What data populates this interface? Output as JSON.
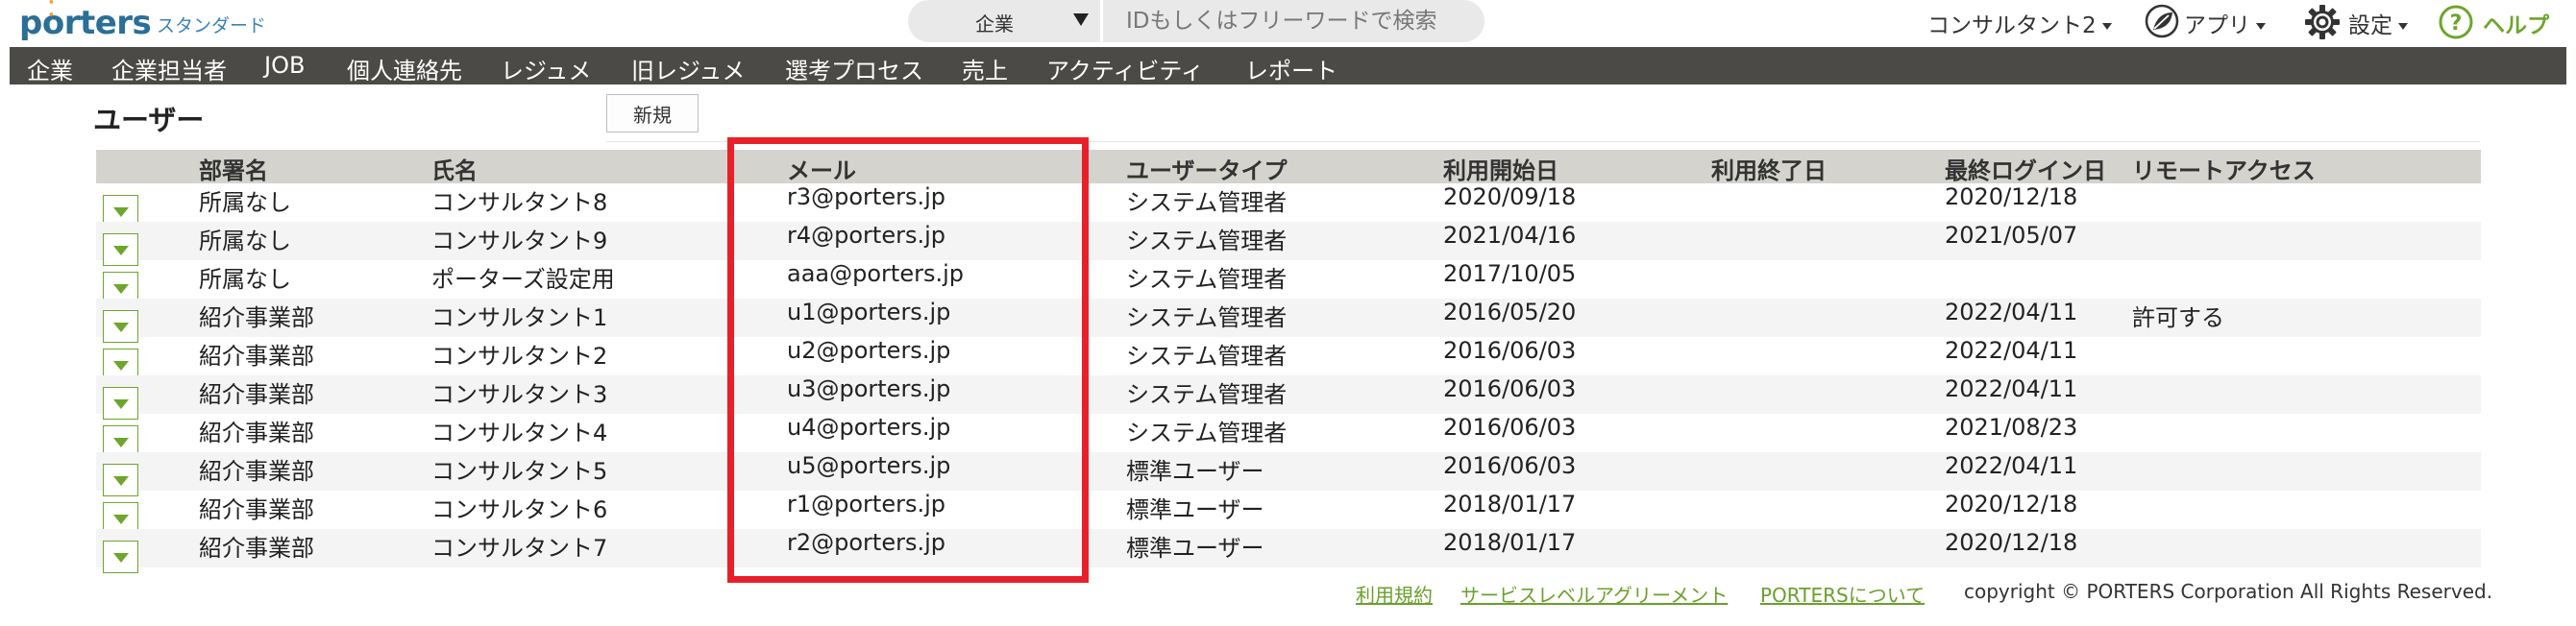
{
  "header": {
    "logo_prefix": "p",
    "logo_rest": "rters",
    "plan": "スタンダード",
    "search": {
      "category": "企業",
      "placeholder": "IDもしくはフリーワードで検索"
    },
    "user_menu": "コンサルタント2",
    "apps_label": "アプリ",
    "settings_label": "設定",
    "help_label": "ヘルプ"
  },
  "nav": [
    "企業",
    "企業担当者",
    "JOB",
    "個人連絡先",
    "レジュメ",
    "旧レジュメ",
    "選考プロセス",
    "売上",
    "アクティビティ",
    "レポート"
  ],
  "page": {
    "title": "ユーザー",
    "new_button": "新規"
  },
  "table": {
    "columns": [
      "部署名",
      "氏名",
      "メール",
      "ユーザータイプ",
      "利用開始日",
      "利用終了日",
      "最終ログイン日",
      "リモートアクセス"
    ],
    "rows": [
      [
        "所属なし",
        "コンサルタント8",
        "r3@porters.jp",
        "システム管理者",
        "2020/09/18",
        "",
        "2020/12/18",
        ""
      ],
      [
        "所属なし",
        "コンサルタント9",
        "r4@porters.jp",
        "システム管理者",
        "2021/04/16",
        "",
        "2021/05/07",
        ""
      ],
      [
        "所属なし",
        "ポーターズ設定用",
        "aaa@porters.jp",
        "システム管理者",
        "2017/10/05",
        "",
        "",
        ""
      ],
      [
        "紹介事業部",
        "コンサルタント1",
        "u1@porters.jp",
        "システム管理者",
        "2016/05/20",
        "",
        "2022/04/11",
        "許可する"
      ],
      [
        "紹介事業部",
        "コンサルタント2",
        "u2@porters.jp",
        "システム管理者",
        "2016/06/03",
        "",
        "2022/04/11",
        ""
      ],
      [
        "紹介事業部",
        "コンサルタント3",
        "u3@porters.jp",
        "システム管理者",
        "2016/06/03",
        "",
        "2022/04/11",
        ""
      ],
      [
        "紹介事業部",
        "コンサルタント4",
        "u4@porters.jp",
        "システム管理者",
        "2016/06/03",
        "",
        "2021/08/23",
        ""
      ],
      [
        "紹介事業部",
        "コンサルタント5",
        "u5@porters.jp",
        "標準ユーザー",
        "2016/06/03",
        "",
        "2022/04/11",
        ""
      ],
      [
        "紹介事業部",
        "コンサルタント6",
        "r1@porters.jp",
        "標準ユーザー",
        "2018/01/17",
        "",
        "2020/12/18",
        ""
      ],
      [
        "紹介事業部",
        "コンサルタント7",
        "r2@porters.jp",
        "標準ユーザー",
        "2018/01/17",
        "",
        "2020/12/18",
        ""
      ]
    ]
  },
  "footer": {
    "links": [
      "利用規約",
      "サービスレベルアグリーメント",
      "PORTERSについて"
    ],
    "copyright": "copyright © PORTERS Corporation All Rights Reserved."
  },
  "colors": {
    "nav_bg": "#4b4a46",
    "header_row_bg": "#d4d3cd",
    "accent_green": "#6da62c",
    "highlight_red": "#e8202a",
    "logo_blue": "#2a6f98"
  },
  "icons": [
    "chevron-down-icon",
    "apps-leaf-icon",
    "gear-icon",
    "help-icon",
    "row-menu-icon"
  ]
}
